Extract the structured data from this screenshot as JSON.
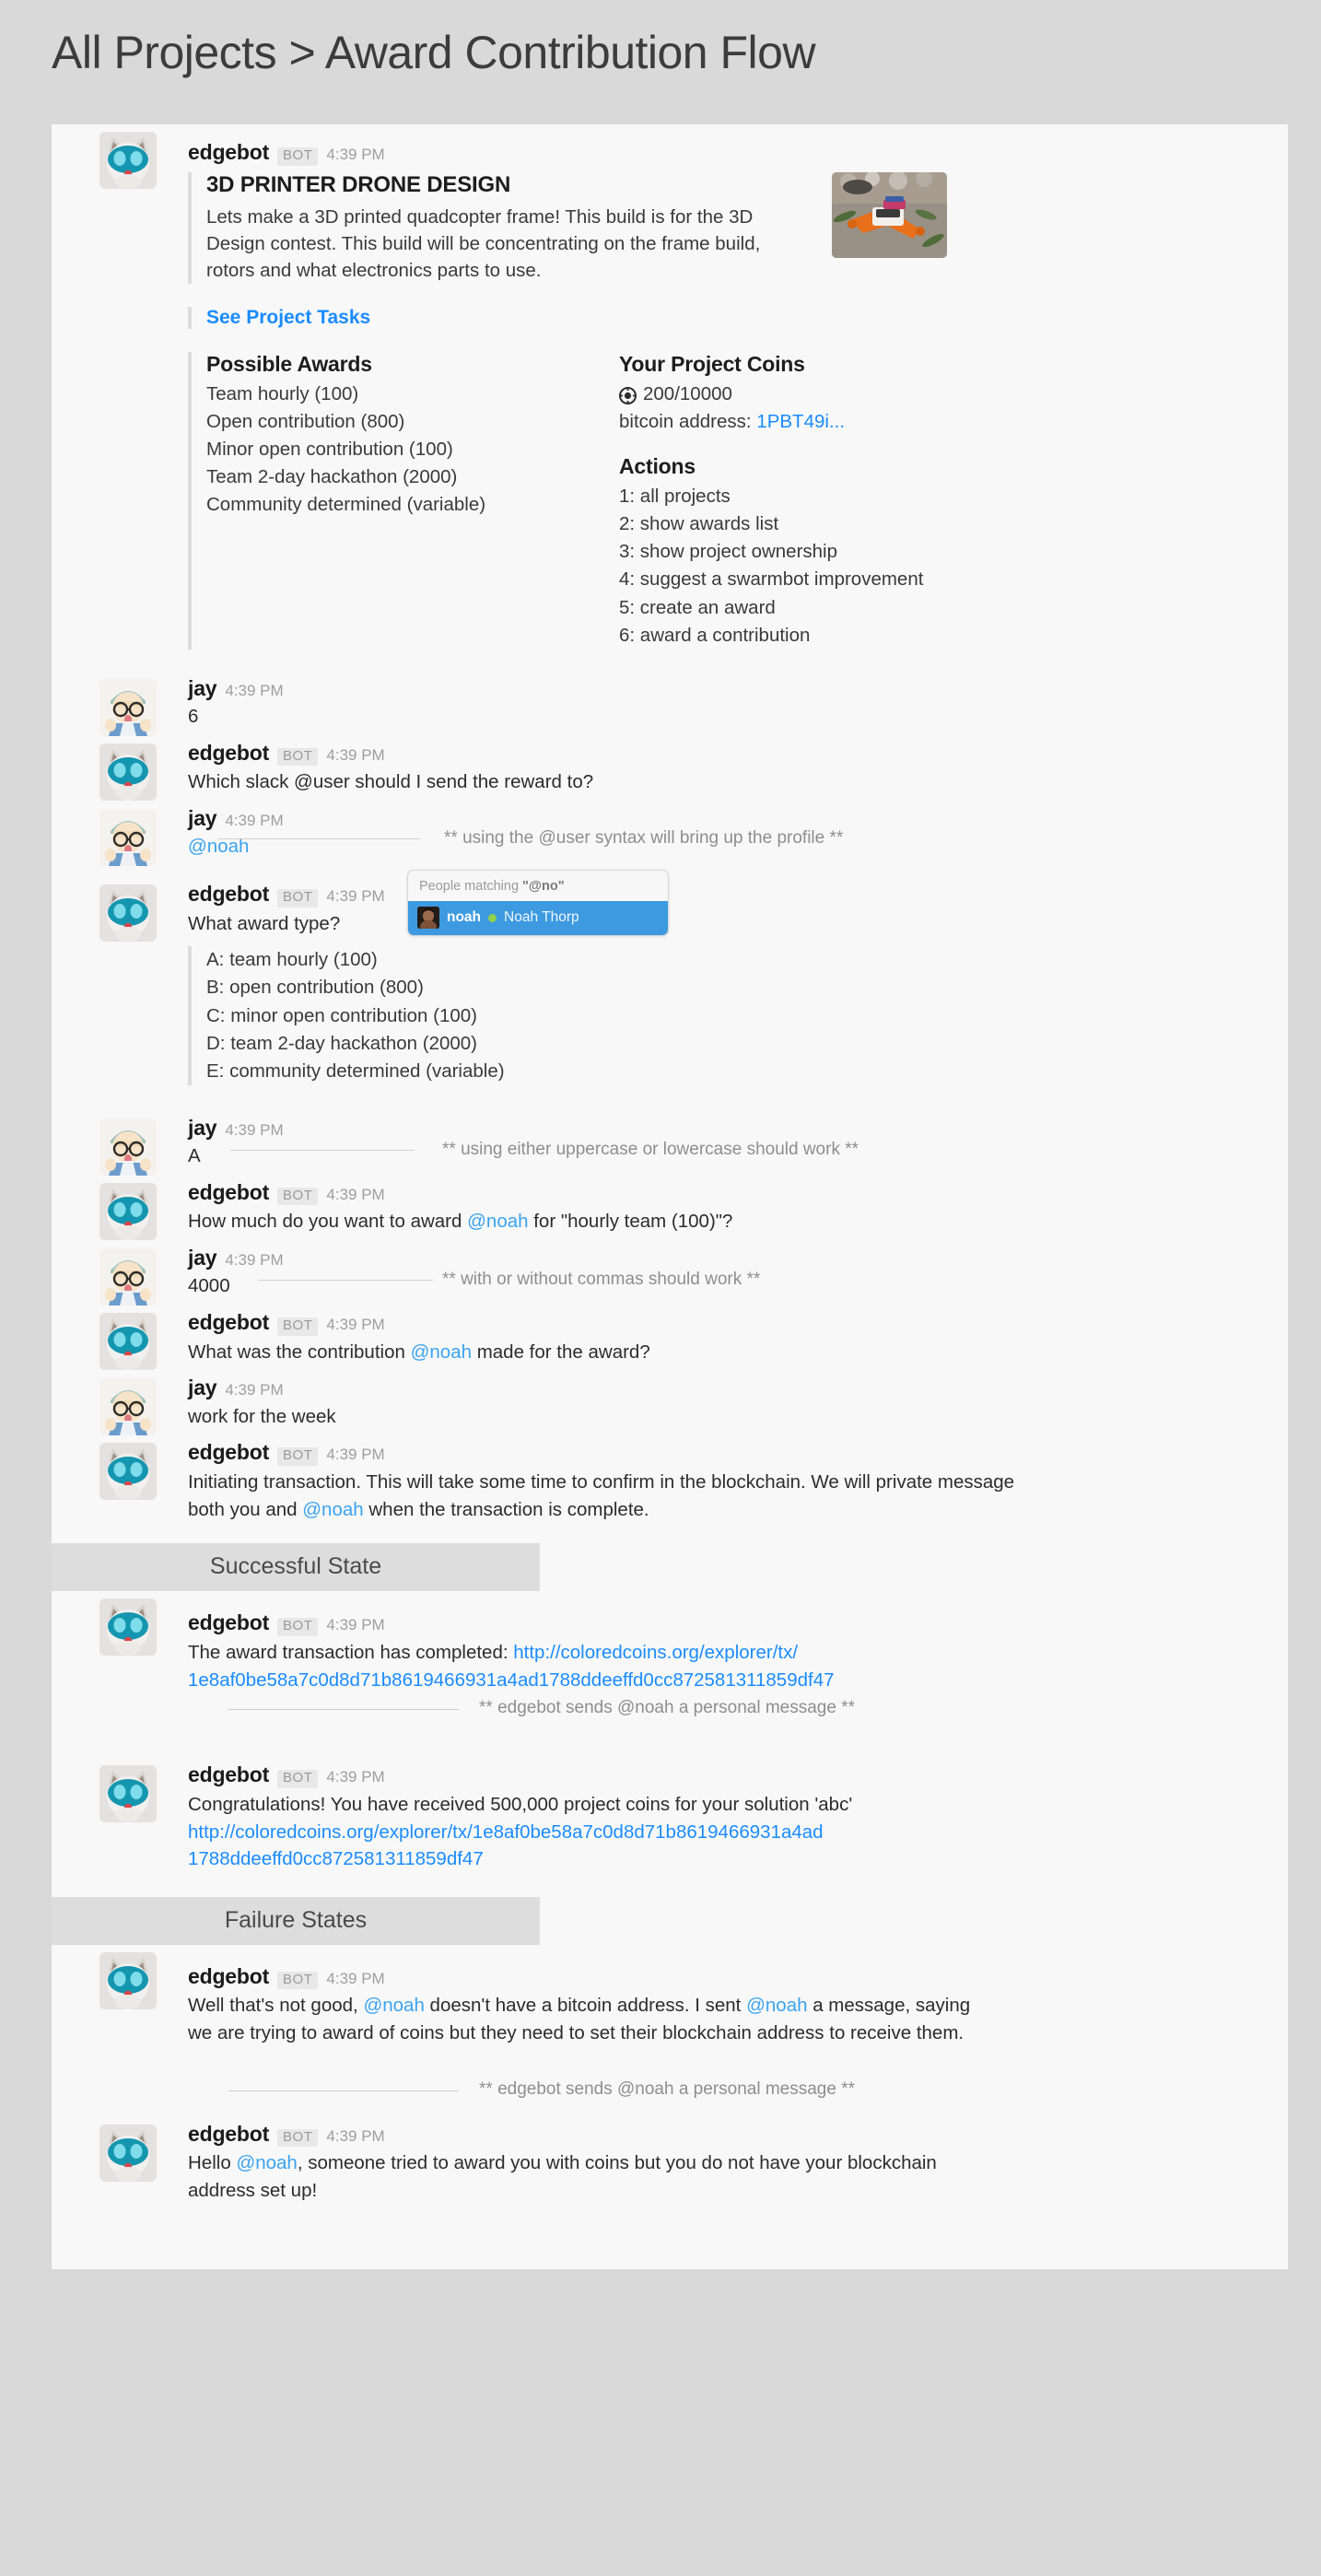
{
  "header": {
    "breadcrumb": "All Projects > Award Contribution Flow"
  },
  "users": {
    "bot": {
      "name": "edgebot",
      "tag": "BOT",
      "time": "4:39 PM"
    },
    "jay": {
      "name": "jay",
      "time": "4:39 PM"
    }
  },
  "project": {
    "title": "3D PRINTER DRONE DESIGN",
    "description": "Lets make a 3D printed quadcopter frame! This build is for the 3D Design contest. This build will be concentrating on the frame build, rotors and what electronics parts to use.",
    "tasks_link": "See Project Tasks",
    "awards_heading": "Possible Awards",
    "awards": [
      "Team hourly (100)",
      "Open contribution (800)",
      "Minor open contribution (100)",
      "Team 2-day hackathon (2000)",
      "Community determined (variable)"
    ],
    "coins_heading": "Your Project Coins",
    "coins_value": "200/10000",
    "bitcoin_label": "bitcoin address:",
    "bitcoin_address": "1PBT49i...",
    "actions_heading": "Actions",
    "actions": [
      "1: all projects",
      "2: show awards list",
      "3: show project ownership",
      "4: suggest a swarmbot improvement",
      "5: create an award",
      "6: award a contribution"
    ]
  },
  "conversation": {
    "jay_choice": "6",
    "bot_ask_user": "Which slack @user should I send the reward to?",
    "jay_mention": "@noah",
    "anno_mention": "** using the @user syntax will bring up the profile **",
    "bot_ask_type": "What award type?",
    "award_types": [
      "A: team hourly (100)",
      "B: open contribution (800)",
      "C: minor open contribution (100)",
      "D: team 2-day hackathon (2000)",
      "E: community determined (variable)"
    ],
    "jay_letter": "A",
    "anno_case": "** using either uppercase or lowercase should work **",
    "bot_ask_amount_pre": "How much do you want to award ",
    "bot_ask_amount_mention": "@noah",
    "bot_ask_amount_post": " for \"hourly team (100)\"?",
    "jay_amount": "4000",
    "anno_commas": "** with or without commas should work **",
    "bot_ask_contrib_pre": "What was the contribution ",
    "bot_ask_contrib_mention": "@noah",
    "bot_ask_contrib_post": " made for the award?",
    "jay_contrib": "work for the week",
    "bot_initiating_pre": "Initiating transaction. This will take some time to confirm in the blockchain. We will private message both you and ",
    "bot_initiating_mention": "@noah",
    "bot_initiating_post": " when the transaction is complete."
  },
  "popup": {
    "header_pre": "People matching ",
    "header_query": "\"@no\"",
    "username": "noah",
    "fullname": "Noah Thorp"
  },
  "success": {
    "band": "Successful State",
    "completed_label": "The award transaction has completed: ",
    "completed_url_line1": "http://coloredcoins.org/explorer/tx/",
    "completed_url_line2": "1e8af0be58a7c0d8d71b8619466931a4ad1788ddeeffd0cc872581311859df47",
    "anno_dm": "** edgebot sends @noah a personal message **",
    "congrats": "Congratulations! You have received 500,000 project coins for your solution 'abc'",
    "congrats_url_line1": "http://coloredcoins.org/explorer/tx/1e8af0be58a7c0d8d71b8619466931a4ad",
    "congrats_url_line2": "1788ddeeffd0cc872581311859df47"
  },
  "failure": {
    "band": "Failure States",
    "no_addr_p1": "Well that's not good, ",
    "no_addr_m1": "@noah",
    "no_addr_p2": " doesn't have a bitcoin address. I sent ",
    "no_addr_m2": "@noah",
    "no_addr_p3": " a message, saying we are trying to award of coins but they need to set their blockchain address to receive them.",
    "anno_dm": "** edgebot sends @noah a personal message **",
    "hello_p1": "Hello ",
    "hello_m1": "@noah",
    "hello_p2": ", someone tried to award you with coins but you do not have your blockchain address set up!"
  },
  "colors": {
    "page_bg": "#d9d9d9",
    "panel_bg": "#f8f8f8",
    "link": "#1a8cff",
    "mention": "#3aa3f0",
    "band": "#dddddd",
    "highlight": "#3d9ae0"
  }
}
